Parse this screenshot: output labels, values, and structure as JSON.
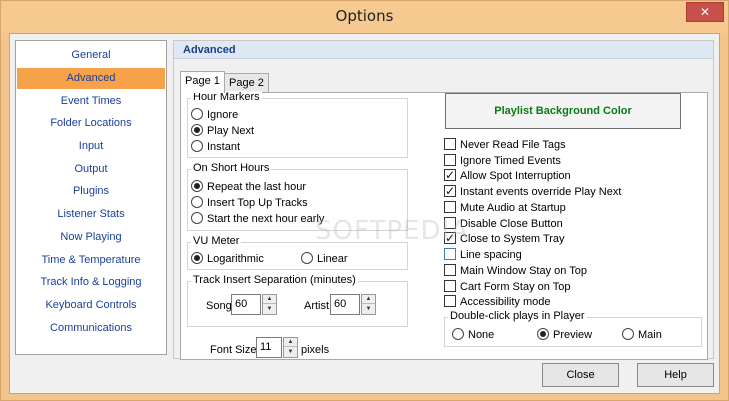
{
  "window": {
    "title": "Options",
    "close_glyph": "✕"
  },
  "sidebar": {
    "items": [
      {
        "label": "General",
        "active": false
      },
      {
        "label": "Advanced",
        "active": true
      },
      {
        "label": "Event Times",
        "active": false
      },
      {
        "label": "Folder Locations",
        "active": false
      },
      {
        "label": "Input",
        "active": false
      },
      {
        "label": "Output",
        "active": false
      },
      {
        "label": "Plugins",
        "active": false
      },
      {
        "label": "Listener Stats",
        "active": false
      },
      {
        "label": "Now Playing",
        "active": false
      },
      {
        "label": "Time & Temperature",
        "active": false
      },
      {
        "label": "Track Info & Logging",
        "active": false
      },
      {
        "label": "Keyboard Controls",
        "active": false
      },
      {
        "label": "Communications",
        "active": false
      }
    ]
  },
  "panel": {
    "header": "Advanced",
    "tabs": [
      {
        "label": "Page 1",
        "active": true
      },
      {
        "label": "Page 2",
        "active": false
      }
    ]
  },
  "hour_markers": {
    "label": "Hour Markers",
    "options": [
      {
        "label": "Ignore",
        "selected": false
      },
      {
        "label": "Play Next",
        "selected": true
      },
      {
        "label": "Instant",
        "selected": false
      }
    ]
  },
  "short_hours": {
    "label": "On Short Hours",
    "options": [
      {
        "label": "Repeat the last hour",
        "selected": true
      },
      {
        "label": "Insert Top Up Tracks",
        "selected": false
      },
      {
        "label": "Start the next hour early",
        "selected": false
      }
    ]
  },
  "vu_meter": {
    "label": "VU Meter",
    "options": [
      {
        "label": "Logarithmic",
        "selected": true
      },
      {
        "label": "Linear",
        "selected": false
      }
    ]
  },
  "separation": {
    "label": "Track Insert Separation (minutes)",
    "song_label": "Song",
    "song_value": "60",
    "artist_label": "Artist",
    "artist_value": "60"
  },
  "font_size": {
    "label": "Font Size",
    "value": "11",
    "unit": "pixels"
  },
  "playlist_bg_button": "Playlist Background Color",
  "checkboxes": [
    {
      "label": "Never Read File Tags",
      "checked": false
    },
    {
      "label": "Ignore Timed Events",
      "checked": false
    },
    {
      "label": "Allow Spot Interruption",
      "checked": true
    },
    {
      "label": "Instant events override Play Next",
      "checked": true
    },
    {
      "label": "Mute Audio at Startup",
      "checked": false
    },
    {
      "label": "Disable Close Button",
      "checked": false
    },
    {
      "label": "Close to System Tray",
      "checked": true
    },
    {
      "label": "Line spacing",
      "checked": false
    },
    {
      "label": "Main Window Stay on Top",
      "checked": false
    },
    {
      "label": "Cart Form Stay on Top",
      "checked": false
    },
    {
      "label": "Accessibility mode",
      "checked": false
    }
  ],
  "double_click": {
    "label": "Double-click plays in Player",
    "options": [
      {
        "label": "None",
        "selected": false
      },
      {
        "label": "Preview",
        "selected": true
      },
      {
        "label": "Main",
        "selected": false
      }
    ]
  },
  "footer": {
    "close_label": "Close",
    "help_label": "Help"
  },
  "watermark": "SOFTPEDIA",
  "colors": {
    "accent": "#f6a24b",
    "nav_text": "#1a3f9a",
    "title_bar": "#f5c990",
    "button_green": "#0a7a12"
  }
}
